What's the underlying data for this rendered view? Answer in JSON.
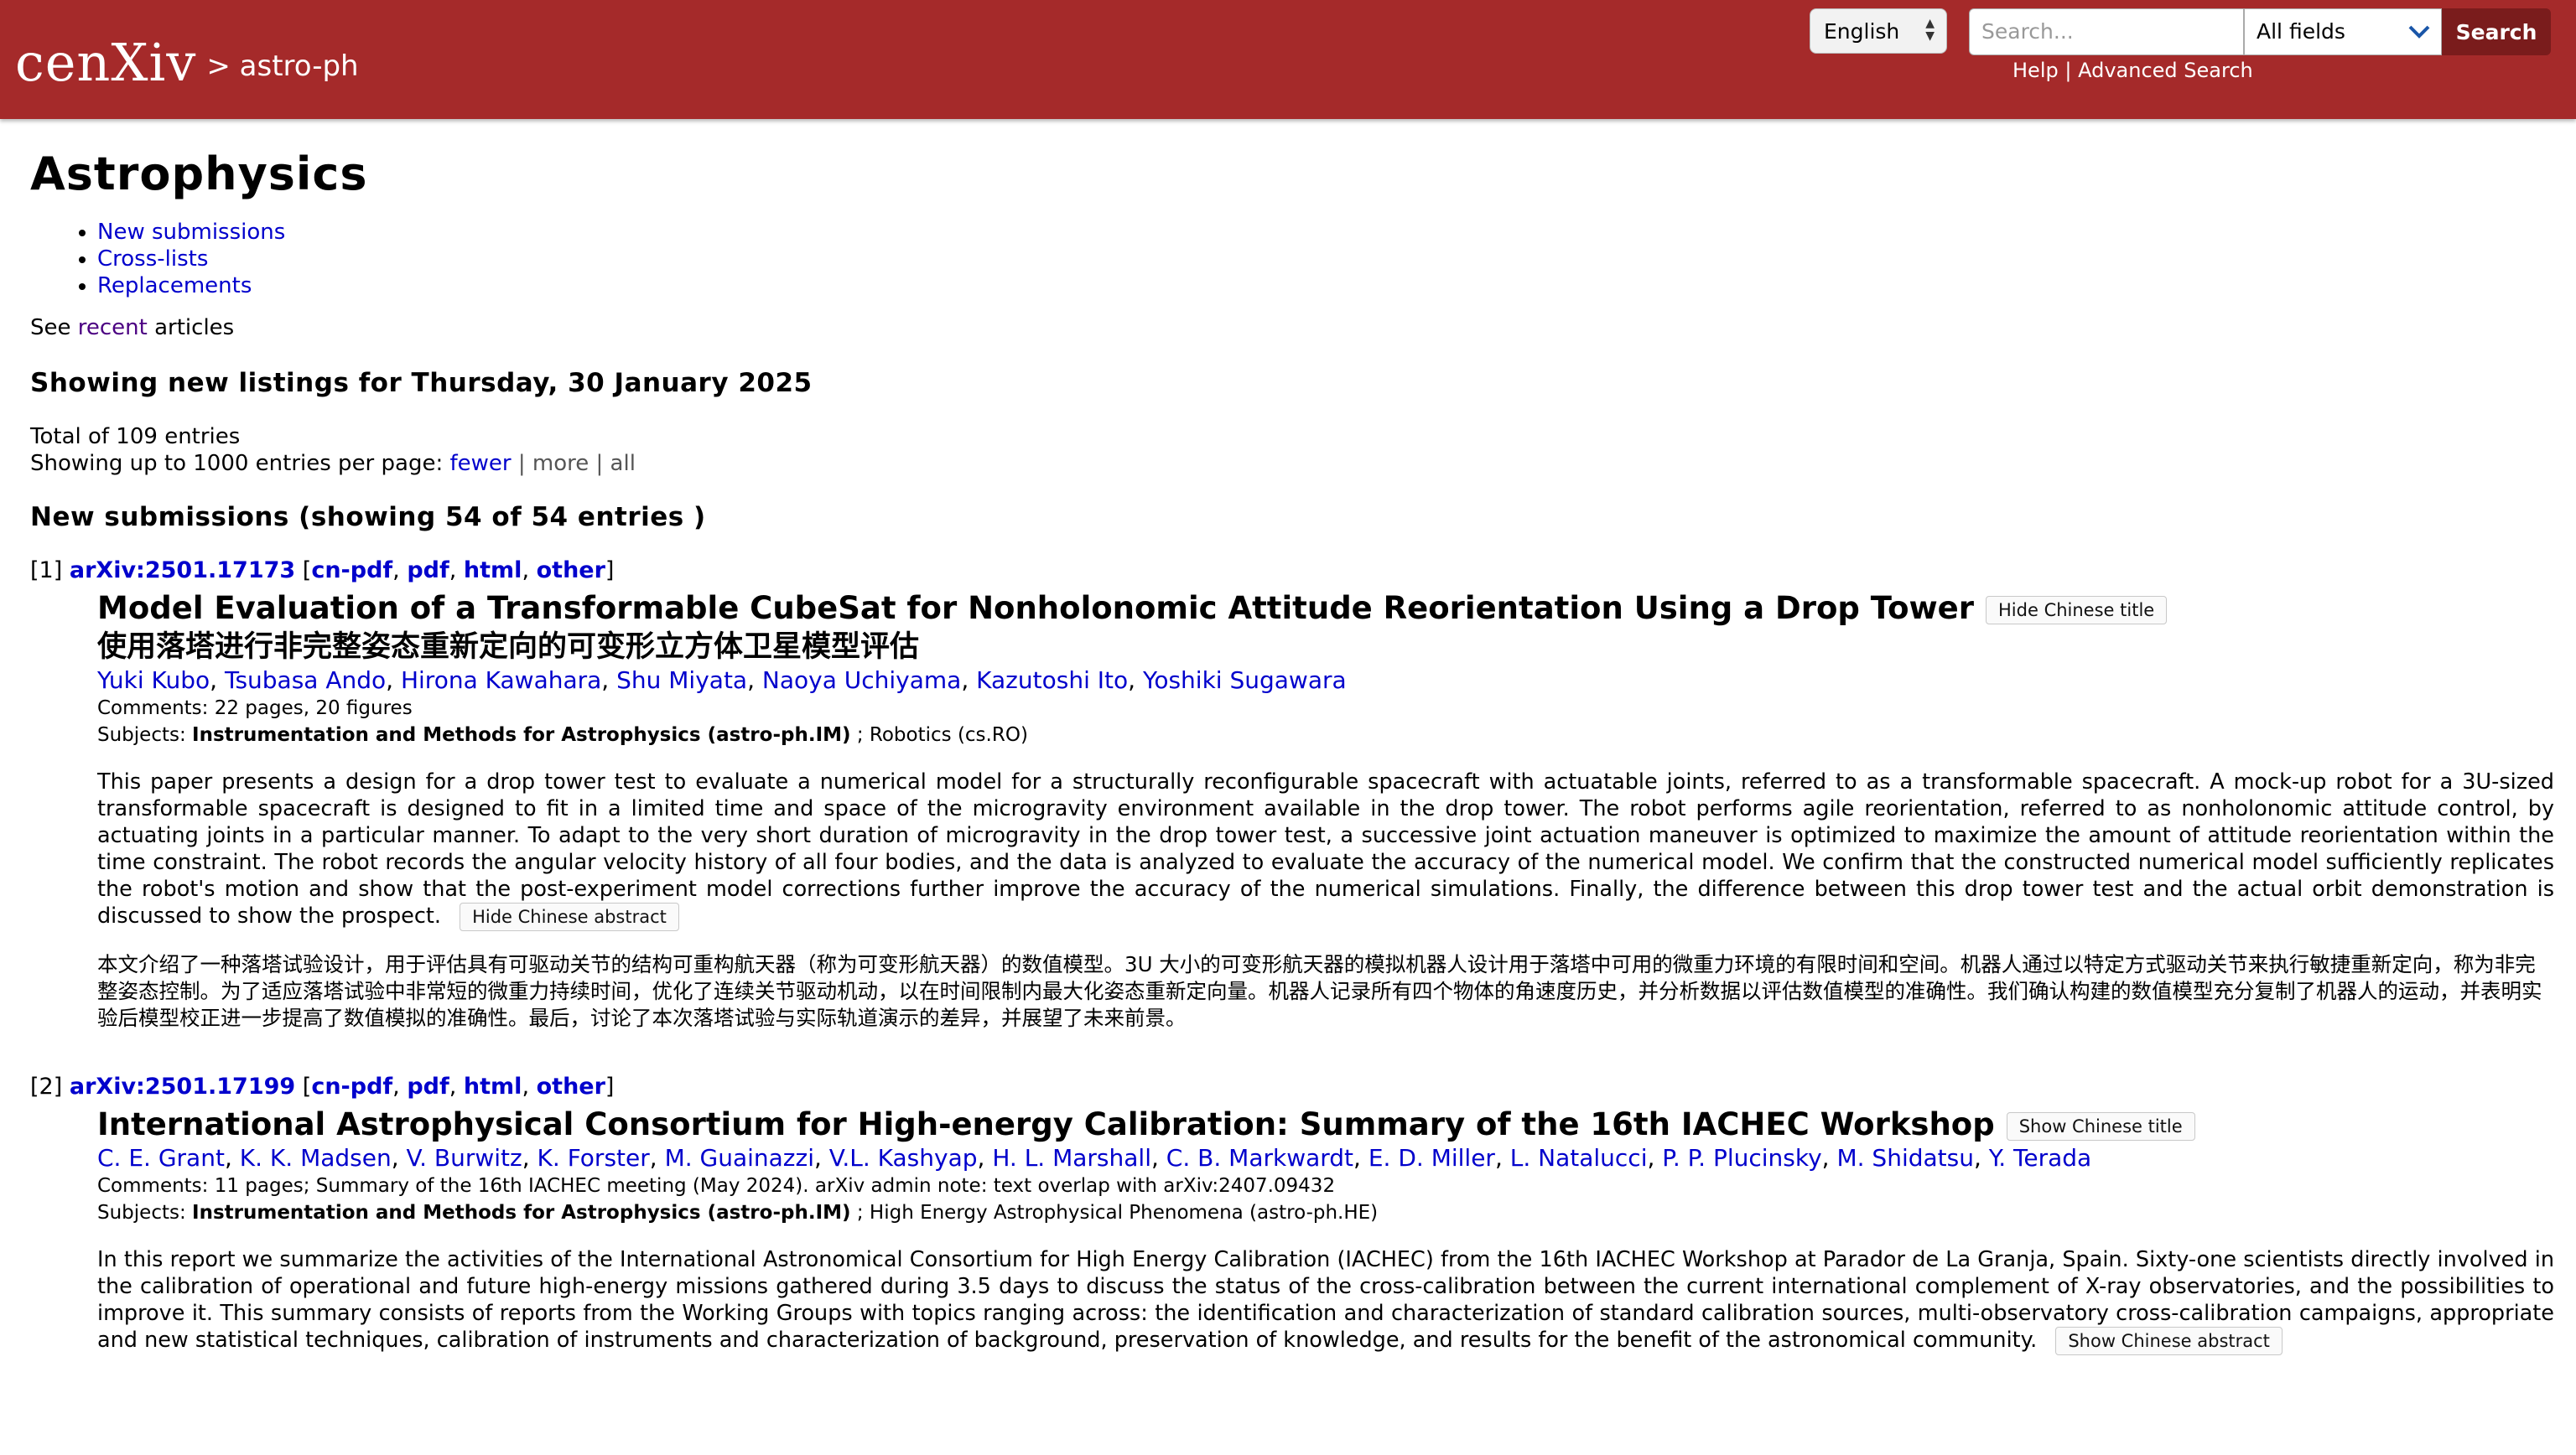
{
  "header": {
    "logo": "cen",
    "logo_x": "Xiv",
    "crumb": "> astro-ph",
    "language": "English",
    "search_placeholder": "Search...",
    "field": "All fields",
    "search_label": "Search",
    "help": "Help",
    "sep": "|",
    "advanced": "Advanced Search"
  },
  "page": {
    "title": "Astrophysics",
    "nav": [
      "New submissions",
      "Cross-lists",
      "Replacements"
    ],
    "see_prefix": "See",
    "see_link": "recent",
    "see_suffix": "articles",
    "listing_heading": "Showing new listings for Thursday, 30 January 2025",
    "total": "Total of 109 entries",
    "per_page_prefix": "Showing up to 1000 entries per page:",
    "fewer": "fewer",
    "more": "more",
    "all": "all",
    "section_heading": "New submissions (showing 54 of 54 entries )"
  },
  "entries": [
    {
      "num": "[1]",
      "id": "arXiv:2501.17173",
      "links": [
        "cn-pdf",
        "pdf",
        "html",
        "other"
      ],
      "title": "Model Evaluation of a Transformable CubeSat for Nonholonomic Attitude Reorientation Using a Drop Tower",
      "title_btn": "Hide Chinese title",
      "cn_title": "使用落塔进行非完整姿态重新定向的可变形立方体卫星模型评估",
      "authors": [
        "Yuki Kubo",
        "Tsubasa Ando",
        "Hirona Kawahara",
        "Shu Miyata",
        "Naoya Uchiyama",
        "Kazutoshi Ito",
        "Yoshiki Sugawara"
      ],
      "comments": "Comments: 22 pages, 20 figures",
      "subjects_label": "Subjects:",
      "primary_subject": "Instrumentation and Methods for Astrophysics (astro-ph.IM)",
      "other_subjects": "; Robotics (cs.RO)",
      "abstract": "This paper presents a design for a drop tower test to evaluate a numerical model for a structurally reconfigurable spacecraft with actuatable joints, referred to as a transformable spacecraft. A mock-up robot for a 3U-sized transformable spacecraft is designed to fit in a limited time and space of the microgravity environment available in the drop tower. The robot performs agile reorientation, referred to as nonholonomic attitude control, by actuating joints in a particular manner. To adapt to the very short duration of microgravity in the drop tower test, a successive joint actuation maneuver is optimized to maximize the amount of attitude reorientation within the time constraint. The robot records the angular velocity history of all four bodies, and the data is analyzed to evaluate the accuracy of the numerical model. We confirm that the constructed numerical model sufficiently replicates the robot's motion and show that the post-experiment model corrections further improve the accuracy of the numerical simulations. Finally, the difference between this drop tower test and the actual orbit demonstration is discussed to show the prospect.",
      "abstract_btn": "Hide Chinese abstract",
      "cn_abstract": "本文介绍了一种落塔试验设计，用于评估具有可驱动关节的结构可重构航天器（称为可变形航天器）的数值模型。3U 大小的可变形航天器的模拟机器人设计用于落塔中可用的微重力环境的有限时间和空间。机器人通过以特定方式驱动关节来执行敏捷重新定向，称为非完整姿态控制。为了适应落塔试验中非常短的微重力持续时间，优化了连续关节驱动机动，以在时间限制内最大化姿态重新定向量。机器人记录所有四个物体的角速度历史，并分析数据以评估数值模型的准确性。我们确认构建的数值模型充分复制了机器人的运动，并表明实验后模型校正进一步提高了数值模拟的准确性。最后，讨论了本次落塔试验与实际轨道演示的差异，并展望了未来前景。"
    },
    {
      "num": "[2]",
      "id": "arXiv:2501.17199",
      "links": [
        "cn-pdf",
        "pdf",
        "html",
        "other"
      ],
      "title": "International Astrophysical Consortium for High-energy Calibration: Summary of the 16th IACHEC Workshop",
      "title_btn": "Show Chinese title",
      "authors": [
        "C. E. Grant",
        "K. K. Madsen",
        "V. Burwitz",
        "K. Forster",
        "M. Guainazzi",
        "V.L. Kashyap",
        "H. L. Marshall",
        "C. B. Markwardt",
        "E. D. Miller",
        "L. Natalucci",
        "P. P. Plucinsky",
        "M. Shidatsu",
        "Y. Terada"
      ],
      "comments": "Comments: 11 pages; Summary of the 16th IACHEC meeting (May 2024). arXiv admin note: text overlap with arXiv:2407.09432",
      "subjects_label": "Subjects:",
      "primary_subject": "Instrumentation and Methods for Astrophysics (astro-ph.IM)",
      "other_subjects": "; High Energy Astrophysical Phenomena (astro-ph.HE)",
      "abstract": "In this report we summarize the activities of the International Astronomical Consortium for High Energy Calibration (IACHEC) from the 16th IACHEC Workshop at Parador de La Granja, Spain. Sixty-one scientists directly involved in the calibration of operational and future high-energy missions gathered during 3.5 days to discuss the status of the cross-calibration between the current international complement of X-ray observatories, and the possibilities to improve it. This summary consists of reports from the Working Groups with topics ranging across: the identification and characterization of standard calibration sources, multi-observatory cross-calibration campaigns, appropriate and new statistical techniques, calibration of instruments and characterization of background, preservation of knowledge, and results for the benefit of the astronomical community.",
      "abstract_btn": "Show Chinese abstract"
    }
  ]
}
